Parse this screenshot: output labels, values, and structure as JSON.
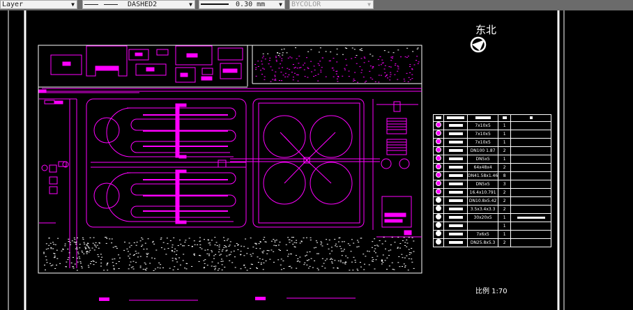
{
  "toolbar": {
    "layer": {
      "value": "Layer"
    },
    "linetype": {
      "value": "DASHED2"
    },
    "lineweight": {
      "value": "0.30 mm"
    },
    "plotstyle": {
      "value": "BYCOLOR"
    }
  },
  "drawing": {
    "north_label": "东北",
    "scale_label": "比例 1:70",
    "colors": {
      "background": "#000000",
      "linework": "#ff00ff",
      "frame": "#ffffff"
    }
  },
  "equipment_table": {
    "rows": [
      {
        "spec": "7x10x5",
        "qty": "1"
      },
      {
        "spec": "7x10x5",
        "qty": "1"
      },
      {
        "spec": "7x10x5",
        "qty": "1"
      },
      {
        "spec": "DN100 1.87",
        "qty": "2"
      },
      {
        "spec": "DN5x5",
        "qty": "1"
      },
      {
        "spec": "64x48x4",
        "qty": "2"
      },
      {
        "spec": "DN41.58x1.46",
        "qty": "8"
      },
      {
        "spec": "DN5x5",
        "qty": "3"
      },
      {
        "spec": "16.4x10.791",
        "qty": "2"
      },
      {
        "spec": "DN10.8x5.42",
        "qty": "2"
      },
      {
        "spec": "3.5x3.4x3.3",
        "qty": "2"
      },
      {
        "spec": "30x20x5",
        "qty": "1"
      },
      {
        "spec": "",
        "qty": "1"
      },
      {
        "spec": "7x6x5",
        "qty": "1"
      },
      {
        "spec": "DN25.8x5.3",
        "qty": "2"
      }
    ]
  }
}
